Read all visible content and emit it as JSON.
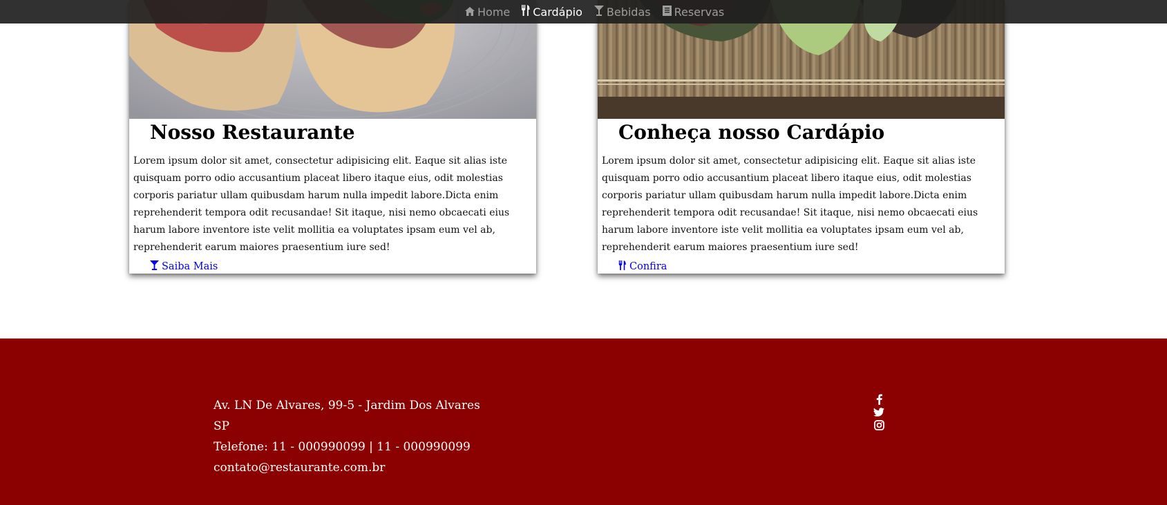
{
  "nav": {
    "items": [
      {
        "label": "Home",
        "icon": "home-icon",
        "active": false
      },
      {
        "label": "Cardápio",
        "icon": "cutlery-icon",
        "active": true
      },
      {
        "label": "Bebidas",
        "icon": "cocktail-icon",
        "active": false
      },
      {
        "label": "Reservas",
        "icon": "book-icon",
        "active": false
      }
    ]
  },
  "cards": [
    {
      "title": "Nosso Restaurante",
      "text": "Lorem ipsum dolor sit amet, consectetur adipisicing elit. Eaque sit alias iste quisquam porro odio accusantium placeat libero itaque eius, odit molestias corporis pariatur ullam quibusdam harum nulla impedit labore.Dicta enim reprehenderit tempora odit recusandae! Sit itaque, nisi nemo obcaecati eius harum labore inventore iste velit mollitia ea voluptates ipsam eum vel ab, reprehenderit earum maiores praesentium iure sed!",
      "link_label": "Saiba Mais",
      "link_icon": "cocktail-icon"
    },
    {
      "title": "Conheça nosso Cardápio",
      "text": "Lorem ipsum dolor sit amet, consectetur adipisicing elit. Eaque sit alias iste quisquam porro odio accusantium placeat libero itaque eius, odit molestias corporis pariatur ullam quibusdam harum nulla impedit labore.Dicta enim reprehenderit tempora odit recusandae! Sit itaque, nisi nemo obcaecati eius harum labore inventore iste velit mollitia ea voluptates ipsam eum vel ab, reprehenderit earum maiores praesentium iure sed!",
      "link_label": "Confira",
      "link_icon": "cutlery-icon"
    }
  ],
  "footer": {
    "address": "Av. LN De Alvares, 99-5 - Jardim Dos Alvares",
    "state": "SP",
    "phone": "Telefone: 11 - 000990099 | 11 - 000990099",
    "email": "contato@restaurante.com.br",
    "social": [
      "facebook-icon",
      "twitter-icon",
      "instagram-icon"
    ]
  },
  "colors": {
    "nav_bg": "#202020",
    "footer_bg": "#8b0000",
    "link": "#0000ee"
  }
}
